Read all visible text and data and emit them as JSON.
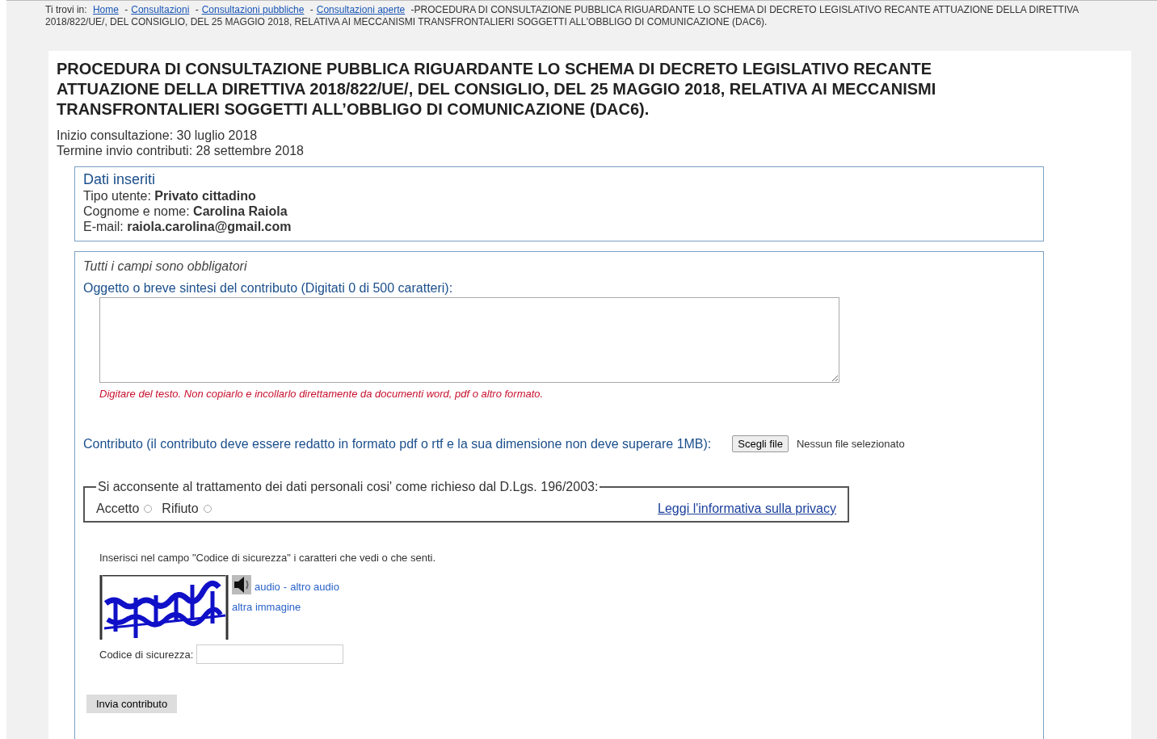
{
  "breadcrumb": {
    "label": "Ti trovi in:",
    "separator": "-",
    "links": [
      "Home",
      "Consultazioni",
      "Consultazioni pubbliche",
      "Consultazioni aperte"
    ],
    "current": "PROCEDURA DI CONSULTAZIONE PUBBLICA RIGUARDANTE LO SCHEMA DI DECRETO LEGISLATIVO RECANTE ATTUAZIONE DELLA DIRETTIVA 2018/822/UE/, DEL CONSIGLIO, DEL 25 MAGGIO 2018, RELATIVA AI MECCANISMI TRANSFRONTALIERI SOGGETTI ALL'OBBLIGO DI COMUNICAZIONE (DAC6)."
  },
  "title": "PROCEDURA DI CONSULTAZIONE PUBBLICA RIGUARDANTE LO SCHEMA DI DECRETO LEGISLATIVO RECANTE ATTUAZIONE DELLA DIRETTIVA 2018/822/UE/, DEL CONSIGLIO, DEL 25 MAGGIO 2018, RELATIVA AI MECCANISMI TRANSFRONTALIERI SOGGETTI ALL’OBBLIGO DI COMUNICAZIONE (DAC6).",
  "dates": [
    {
      "label": "Inizio consultazione:",
      "value": "30 luglio 2018"
    },
    {
      "label": "Termine invio contributi:",
      "value": "28 settembre 2018"
    }
  ],
  "entered_data": {
    "heading": "Dati inseriti",
    "fields": [
      {
        "label": "Tipo utente:",
        "value": "Privato cittadino"
      },
      {
        "label": "Cognome e nome:",
        "value": "Carolina Raiola"
      },
      {
        "label": "E-mail:",
        "value": "raiola.carolina@gmail.com"
      }
    ]
  },
  "form": {
    "required_note": "Tutti i campi sono obbligatori",
    "subject_label": "Oggetto o breve sintesi del contributo (Digitati 0 di 500 caratteri):",
    "subject_hint": "Digitare del testo. Non copiarlo e incollarlo direttamente da documenti word, pdf o altro formato.",
    "file": {
      "label": "Contributo (il contributo deve essere redatto in formato pdf o rtf e la sua dimensione non deve superare 1MB):",
      "button": "Scegli file",
      "status": "Nessun file selezionato"
    },
    "consent": {
      "legend": "Si acconsente al trattamento dei dati personali cosi' come richieso dal D.Lgs. 196/2003:",
      "options": [
        {
          "label": "Accetto",
          "selected": false
        },
        {
          "label": "Rifiuto",
          "selected": false
        }
      ],
      "privacy_link": "Leggi l'informativa sulla privacy"
    },
    "captcha": {
      "instructions": "Inserisci nel campo \"Codice di sicurezza\" i caratteri che vedi o che senti.",
      "audio_link": "audio",
      "separator": "-",
      "other_audio_link": "altro audio",
      "other_image_link": "altra immagine",
      "code_label": "Codice di sicurezza:"
    },
    "submit": "Invia contributo"
  }
}
